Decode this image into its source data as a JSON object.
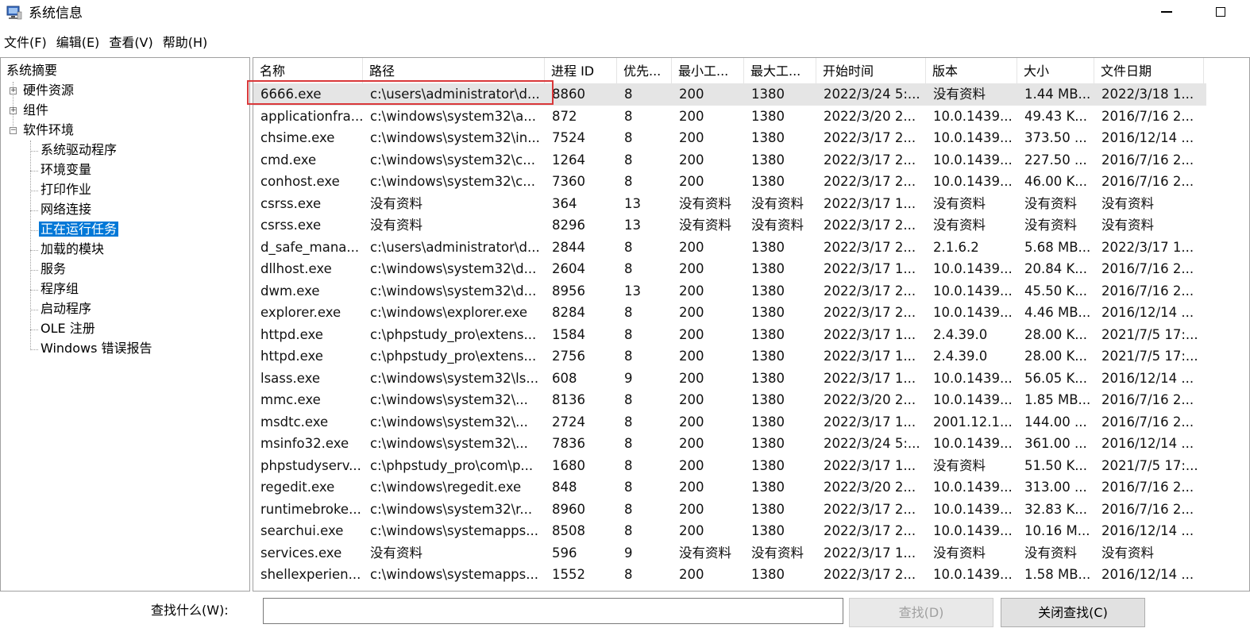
{
  "window": {
    "title": "系统信息"
  },
  "menu": [
    "文件(F)",
    "编辑(E)",
    "查看(V)",
    "帮助(H)"
  ],
  "tree": {
    "root": "系统摘要",
    "groups": [
      {
        "label": "硬件资源",
        "expander": "+"
      },
      {
        "label": "组件",
        "expander": "+"
      },
      {
        "label": "软件环境",
        "expander": "−"
      }
    ],
    "children": [
      "系统驱动程序",
      "环境变量",
      "打印作业",
      "网络连接",
      "正在运行任务",
      "加载的模块",
      "服务",
      "程序组",
      "启动程序",
      "OLE 注册",
      "Windows 错误报告"
    ],
    "selected": "正在运行任务"
  },
  "table": {
    "columns": [
      "名称",
      "路径",
      "进程 ID",
      "优先...",
      "最小工...",
      "最大工...",
      "开始时间",
      "版本",
      "大小",
      "文件日期"
    ],
    "rows": [
      [
        "6666.exe",
        "c:\\users\\administrator\\d...",
        "8860",
        "8",
        "200",
        "1380",
        "2022/3/24 5:...",
        "没有资料",
        "1.44 MB...",
        "2022/3/18 1..."
      ],
      [
        "applicationfra...",
        "c:\\windows\\system32\\a...",
        "872",
        "8",
        "200",
        "1380",
        "2022/3/20 2...",
        "10.0.1439...",
        "49.43 K...",
        "2016/7/16 2..."
      ],
      [
        "chsime.exe",
        "c:\\windows\\system32\\in...",
        "7524",
        "8",
        "200",
        "1380",
        "2022/3/17 2...",
        "10.0.1439...",
        "373.50 ...",
        "2016/12/14 ..."
      ],
      [
        "cmd.exe",
        "c:\\windows\\system32\\c...",
        "1264",
        "8",
        "200",
        "1380",
        "2022/3/17 2...",
        "10.0.1439...",
        "227.50 ...",
        "2016/7/16 2..."
      ],
      [
        "conhost.exe",
        "c:\\windows\\system32\\c...",
        "7360",
        "8",
        "200",
        "1380",
        "2022/3/17 2...",
        "10.0.1439...",
        "46.00 K...",
        "2016/7/16 2..."
      ],
      [
        "csrss.exe",
        "没有资料",
        "364",
        "13",
        "没有资料",
        "没有资料",
        "2022/3/17 1...",
        "没有资料",
        "没有资料",
        "没有资料"
      ],
      [
        "csrss.exe",
        "没有资料",
        "8296",
        "13",
        "没有资料",
        "没有资料",
        "2022/3/17 2...",
        "没有资料",
        "没有资料",
        "没有资料"
      ],
      [
        "d_safe_mana...",
        "c:\\users\\administrator\\d...",
        "2844",
        "8",
        "200",
        "1380",
        "2022/3/17 2...",
        "2.1.6.2",
        "5.68 MB...",
        "2022/3/17 1..."
      ],
      [
        "dllhost.exe",
        "c:\\windows\\system32\\d...",
        "2604",
        "8",
        "200",
        "1380",
        "2022/3/17 1...",
        "10.0.1439...",
        "20.84 K...",
        "2016/7/16 2..."
      ],
      [
        "dwm.exe",
        "c:\\windows\\system32\\d...",
        "8956",
        "13",
        "200",
        "1380",
        "2022/3/17 2...",
        "10.0.1439...",
        "45.50 K...",
        "2016/7/16 2..."
      ],
      [
        "explorer.exe",
        "c:\\windows\\explorer.exe",
        "8284",
        "8",
        "200",
        "1380",
        "2022/3/17 2...",
        "10.0.1439...",
        "4.46 MB...",
        "2016/12/14 ..."
      ],
      [
        "httpd.exe",
        "c:\\phpstudy_pro\\extens...",
        "1584",
        "8",
        "200",
        "1380",
        "2022/3/17 1...",
        "2.4.39.0",
        "28.00 K...",
        "2021/7/5 17:..."
      ],
      [
        "httpd.exe",
        "c:\\phpstudy_pro\\extens...",
        "2756",
        "8",
        "200",
        "1380",
        "2022/3/17 1...",
        "2.4.39.0",
        "28.00 K...",
        "2021/7/5 17:..."
      ],
      [
        "lsass.exe",
        "c:\\windows\\system32\\ls...",
        "608",
        "9",
        "200",
        "1380",
        "2022/3/17 1...",
        "10.0.1439...",
        "56.05 K...",
        "2016/12/14 ..."
      ],
      [
        "mmc.exe",
        "c:\\windows\\system32\\...",
        "8136",
        "8",
        "200",
        "1380",
        "2022/3/20 2...",
        "10.0.1439...",
        "1.85 MB...",
        "2016/7/16 2..."
      ],
      [
        "msdtc.exe",
        "c:\\windows\\system32\\...",
        "2724",
        "8",
        "200",
        "1380",
        "2022/3/17 1...",
        "2001.12.1...",
        "144.00 ...",
        "2016/7/16 2..."
      ],
      [
        "msinfo32.exe",
        "c:\\windows\\system32\\...",
        "7836",
        "8",
        "200",
        "1380",
        "2022/3/24 5:...",
        "10.0.1439...",
        "361.00 ...",
        "2016/12/14 ..."
      ],
      [
        "phpstudyserv...",
        "c:\\phpstudy_pro\\com\\p...",
        "1680",
        "8",
        "200",
        "1380",
        "2022/3/17 1...",
        "没有资料",
        "51.50 K...",
        "2021/7/5 17:..."
      ],
      [
        "regedit.exe",
        "c:\\windows\\regedit.exe",
        "848",
        "8",
        "200",
        "1380",
        "2022/3/20 2...",
        "10.0.1439...",
        "313.00 ...",
        "2016/7/16 2..."
      ],
      [
        "runtimebroke...",
        "c:\\windows\\system32\\r...",
        "8960",
        "8",
        "200",
        "1380",
        "2022/3/17 2...",
        "10.0.1439...",
        "32.83 K...",
        "2016/7/16 2..."
      ],
      [
        "searchui.exe",
        "c:\\windows\\systemapps...",
        "8508",
        "8",
        "200",
        "1380",
        "2022/3/17 2...",
        "10.0.1439...",
        "10.16 M...",
        "2016/12/14 ..."
      ],
      [
        "services.exe",
        "没有资料",
        "596",
        "9",
        "没有资料",
        "没有资料",
        "2022/3/17 1...",
        "没有资料",
        "没有资料",
        "没有资料"
      ],
      [
        "shellexperien...",
        "c:\\windows\\systemapps...",
        "1552",
        "8",
        "200",
        "1380",
        "2022/3/17 2...",
        "10.0.1439...",
        "1.58 MB...",
        "2016/12/14 ..."
      ]
    ]
  },
  "find": {
    "label": "查找什么(W):",
    "value": "",
    "find_button": "查找(D)",
    "close_button": "关闭查找(C)"
  },
  "colors": {
    "selection": "#0078d7",
    "annotation": "#d9383a",
    "row_selected": "#e5e5e5"
  }
}
